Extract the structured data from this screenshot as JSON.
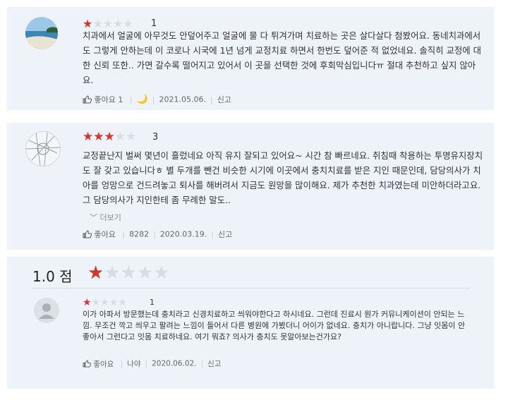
{
  "reviews": [
    {
      "stars_filled": 1,
      "score": "1",
      "text": "치과에서 얼굴에 아무것도 안덮어주고 얼굴에 물 다 튀겨가며 치료하는 곳은 살다살다 첨봤어요. 동네치과에서도 그렇게 안하는데 이 코로나 시국에 1년 넘게 교정치료 하면서 한번도 덮어준 적 없었네요. 솔직히 교정에 대한 신뢰 또한.. 가면 갈수록 떨어지고 있어서 이 곳을 선택한 것에 후회막심입니다ㅠ 절대 추천하고 싶지 않아요.",
      "like_label": "좋아요 1",
      "date": "2021.05.06.",
      "report": "신고"
    },
    {
      "stars_filled": 3,
      "score": "3",
      "text": "교정끝난지 벌써 몇년이 흘렀네요 아직 유지 잘되고 있어요~ 시간 참 빠르네요. 취침때 착용하는 투명유지장치도 잘 갖고 있습니다ㅎ 별 두개를 뺀건 비슷한 시기에 이곳에서 충치치료를 받은 지인 때문인데, 담당의사가 치아를 엉망으로 건드려놓고 퇴사를 해버려서 지금도 원망을 많이해요. 제가 추천한 치과였는데 미안하더라고요. 그 담당의사가 지인한테 좀 무례한 말도..",
      "more": "더보기",
      "like_label": "좋아요",
      "user": "8282",
      "date": "2020.03.19.",
      "report": "신고"
    },
    {
      "header_score": "1.0 점",
      "header_stars_filled": 1,
      "stars_filled": 1,
      "score": "1",
      "text": "이가 아파서 방문했는데 충치라고 신경치료하고 씌워야한다고 하시네요. 그런데 진료시 뭔가 커뮤니케이션이 안되는 느낌. 무조건 깍고 씌우고 팔려는 느낌이 들어서 다른 병원에 가봤더니 어이가 없네요. 충치가 아니랍니다. 그냥 잇몸이 안좋아서 그런다고 잇몸 치료하네요. 여기 뭐죠? 의사가 충치도 못알아보는건가요?",
      "like_label": "좋아요",
      "user": "나야",
      "date": "2020.06.02.",
      "report": "신고"
    }
  ],
  "icons": [
    "beach-avatar",
    "map-avatar",
    "person-avatar",
    "thumbs-up-icon",
    "banana-icon",
    "chevron-down-icon",
    "star-icon"
  ],
  "colors": {
    "star_on": "#d9342c",
    "star_off": "#d8dde4",
    "card_bg": "#eef3fa"
  }
}
